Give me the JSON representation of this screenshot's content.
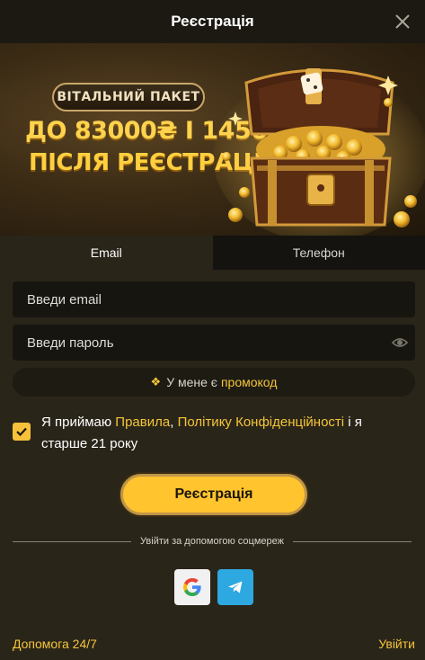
{
  "header": {
    "title": "Реєстрація",
    "close_icon": "close-icon"
  },
  "banner": {
    "badge": "ВІТАЛЬНИЙ ПАКЕТ",
    "line1": "ДО 83000₴ І 1450FS",
    "line2": "ПІСЛЯ РЕЄСТРАЦІЇ"
  },
  "tabs": [
    {
      "label": "Email",
      "active": true
    },
    {
      "label": "Телефон",
      "active": false
    }
  ],
  "form": {
    "email_placeholder": "Введи email",
    "email_value": "",
    "password_placeholder": "Введи пароль",
    "password_value": "",
    "promo_prefix": "У мене є",
    "promo_link": "промокод"
  },
  "consent": {
    "checked": true,
    "t1": "Я приймаю ",
    "rules": "Правила",
    "t2": ", ",
    "privacy": "Політику Конфіденційності",
    "t3": " і я старше 21 року"
  },
  "submit_label": "Реєстрація",
  "social_divider": "Увійти за допомогою соцмереж",
  "social": [
    {
      "name": "google-icon"
    },
    {
      "name": "telegram-icon"
    }
  ],
  "footer": {
    "help": "Допомога 24/7",
    "login": "Увійти"
  },
  "colors": {
    "accent": "#f4c53a",
    "button": "#ffc42e",
    "background": "#2a2519",
    "header": "#1b1912"
  }
}
